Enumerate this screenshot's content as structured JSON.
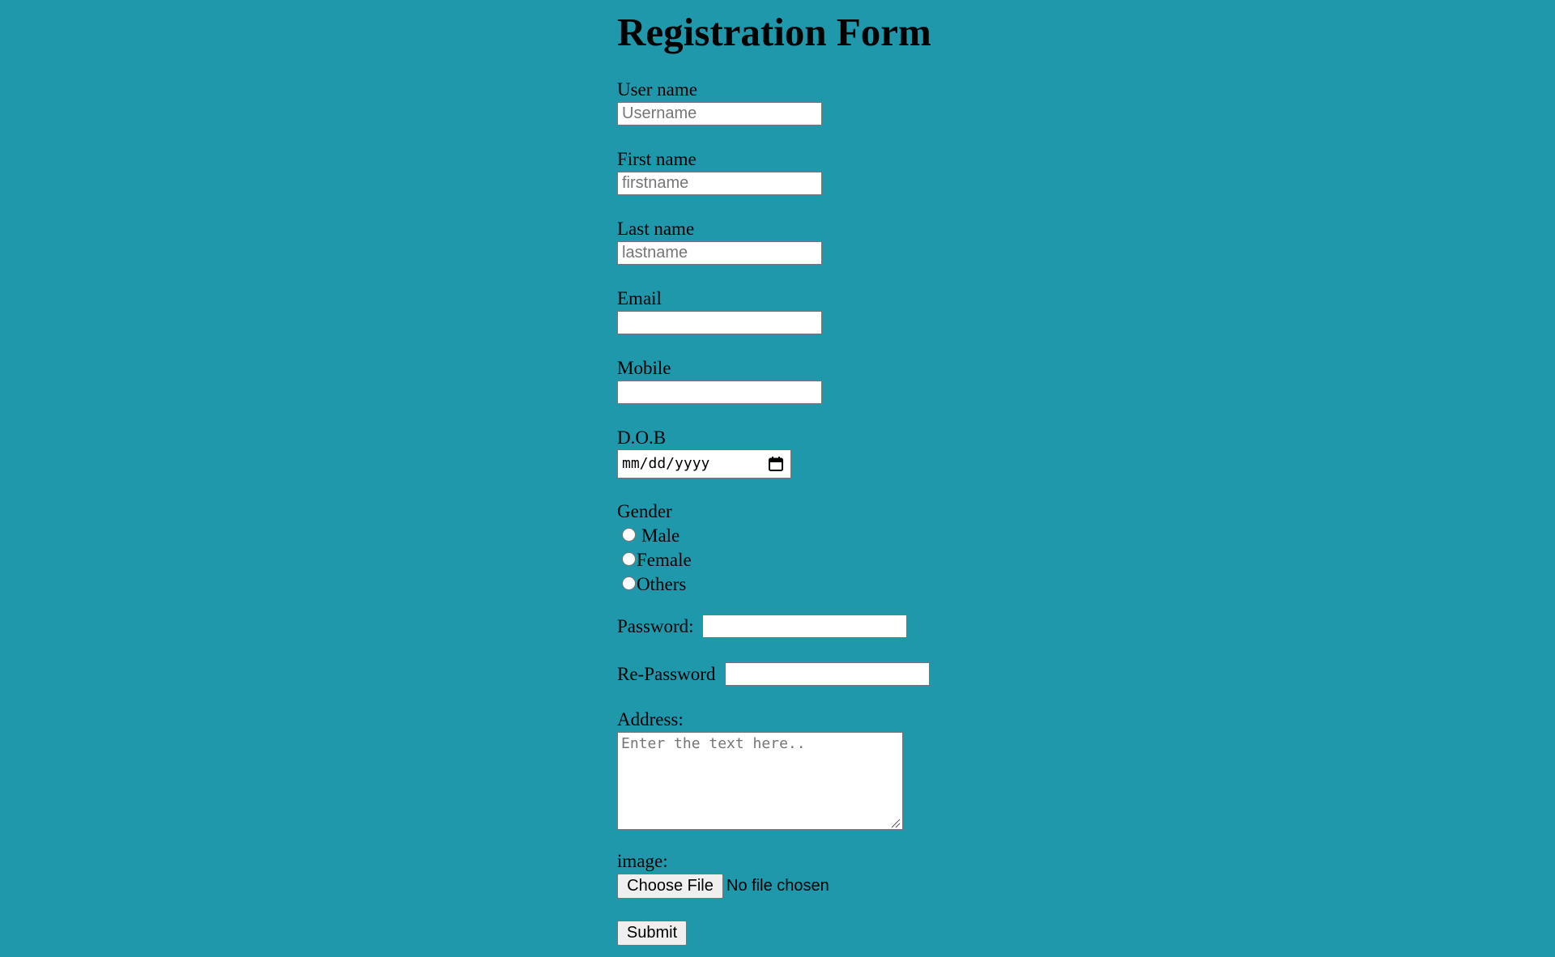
{
  "page": {
    "title": "Registration Form",
    "background_color": "#1f98ac"
  },
  "form": {
    "username": {
      "label": "User name",
      "placeholder": "Username",
      "value": ""
    },
    "firstname": {
      "label": "First name",
      "placeholder": "firstname",
      "value": ""
    },
    "lastname": {
      "label": "Last name",
      "placeholder": "lastname",
      "value": ""
    },
    "email": {
      "label": "Email",
      "value": ""
    },
    "mobile": {
      "label": "Mobile",
      "value": ""
    },
    "dob": {
      "label": "D.O.B",
      "format": "mm/dd/yyyy",
      "icon": "calendar-icon"
    },
    "gender": {
      "label": "Gender",
      "options": [
        {
          "label": "Male",
          "checked": false
        },
        {
          "label": "Female",
          "checked": false
        },
        {
          "label": "Others",
          "checked": false
        }
      ]
    },
    "password": {
      "label": "Password:",
      "value": ""
    },
    "repassword": {
      "label": "Re-Password",
      "value": ""
    },
    "address": {
      "label": "Address:",
      "placeholder": "Enter the text here..",
      "value": ""
    },
    "image": {
      "label": "image:",
      "button_label": "Choose File",
      "status": "No file chosen"
    },
    "submit_label": "Submit"
  }
}
